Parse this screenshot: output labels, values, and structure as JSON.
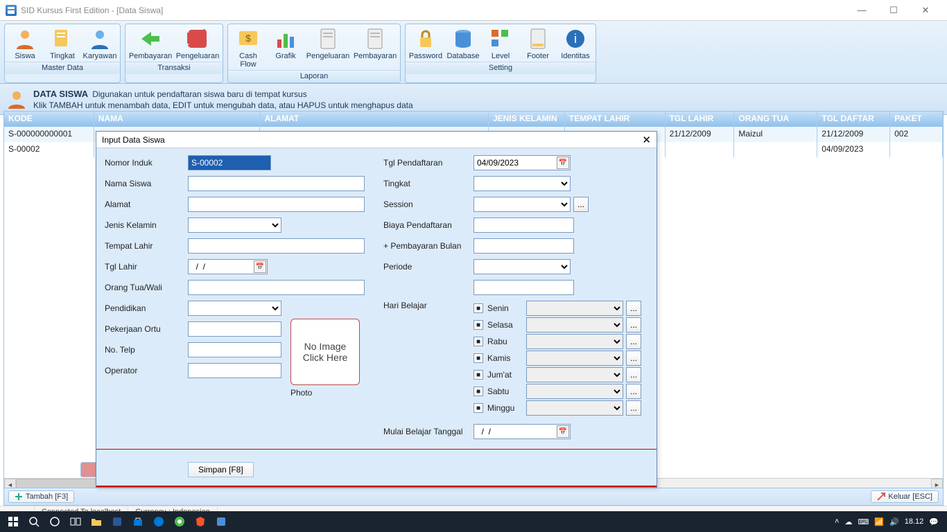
{
  "window": {
    "title": "SID Kursus First Edition - [Data Siswa]"
  },
  "ribbon": {
    "groups": [
      {
        "label": "Master Data",
        "items": [
          "Siswa",
          "Tingkat",
          "Karyawan"
        ]
      },
      {
        "label": "Transaksi",
        "items": [
          "Pembayaran",
          "Pengeluaran"
        ]
      },
      {
        "label": "Laporan",
        "items": [
          "Cash Flow",
          "Grafik",
          "Pengeluaran",
          "Pembayaran"
        ]
      },
      {
        "label": "Setting",
        "items": [
          "Password",
          "Database",
          "Level",
          "Footer",
          "Identitas"
        ]
      }
    ]
  },
  "info": {
    "title": "DATA SISWA",
    "line1": "Digunakan untuk pendaftaran siswa baru di tempat kursus",
    "line2": "Klik TAMBAH untuk menambah data, EDIT untuk mengubah data, atau HAPUS untuk menghapus data"
  },
  "table": {
    "headers": [
      "KODE",
      "NAMA",
      "ALAMAT",
      "JENIS KELAMIN",
      "TEMPAT LAHIR",
      "TGL LAHIR",
      "ORANG TUA",
      "TGL DAFTAR",
      "PAKET"
    ],
    "rows": [
      {
        "kode": "S-000000000001",
        "nama": "",
        "alamat": "",
        "jk": "",
        "tl": "",
        "tgll": "21/12/2009",
        "ortu": "Maizul",
        "tgld": "21/12/2009",
        "paket": "002"
      },
      {
        "kode": "S-00002",
        "nama": "",
        "alamat": "",
        "jk": "",
        "tl": "",
        "tgll": "",
        "ortu": "",
        "tgld": "04/09/2023",
        "paket": ""
      }
    ]
  },
  "bottom": {
    "tambah": "Tambah [F3]",
    "keluar": "Keluar [ESC]"
  },
  "status": {
    "conn": "Connected To localhost",
    "curr": "Currency : Indonesian"
  },
  "tray": {
    "time": "18.12"
  },
  "dialog": {
    "title": "Input Data Siswa",
    "left": {
      "nomor_induk_l": "Nomor Induk",
      "nomor_induk": "S-00002",
      "nama_l": "Nama Siswa",
      "nama": "",
      "alamat_l": "Alamat",
      "alamat": "",
      "jk_l": "Jenis Kelamin",
      "tmp_l": "Tempat Lahir",
      "tmp": "",
      "tgl_lahir_l": "Tgl Lahir",
      "tgl_lahir": "  /  /",
      "ortu_l": "Orang Tua/Wali",
      "ortu": "",
      "pend_l": "Pendidikan",
      "pek_l": "Pekerjaan Ortu",
      "pek": "",
      "telp_l": "No. Telp",
      "telp": "",
      "op_l": "Operator",
      "op": "",
      "photo_l": "Photo",
      "photo_ph": "No Image\nClick Here"
    },
    "right": {
      "tgld_l": "Tgl Pendaftaran",
      "tgld": "04/09/2023",
      "tingkat_l": "Tingkat",
      "session_l": "Session",
      "biaya_l": "Biaya Pendaftaran",
      "biaya": "",
      "bayar_l": "+ Pembayaran Bulan",
      "bayar": "",
      "periode_l": "Periode",
      "periode2": "",
      "hari_l": "Hari Belajar",
      "days": [
        "Senin",
        "Selasa",
        "Rabu",
        "Kamis",
        "Jum'at",
        "Sabtu",
        "Minggu"
      ],
      "mulai_l": "Mulai Belajar Tanggal",
      "mulai": "  /  /"
    },
    "simpan": "Simpan  [F8]"
  }
}
